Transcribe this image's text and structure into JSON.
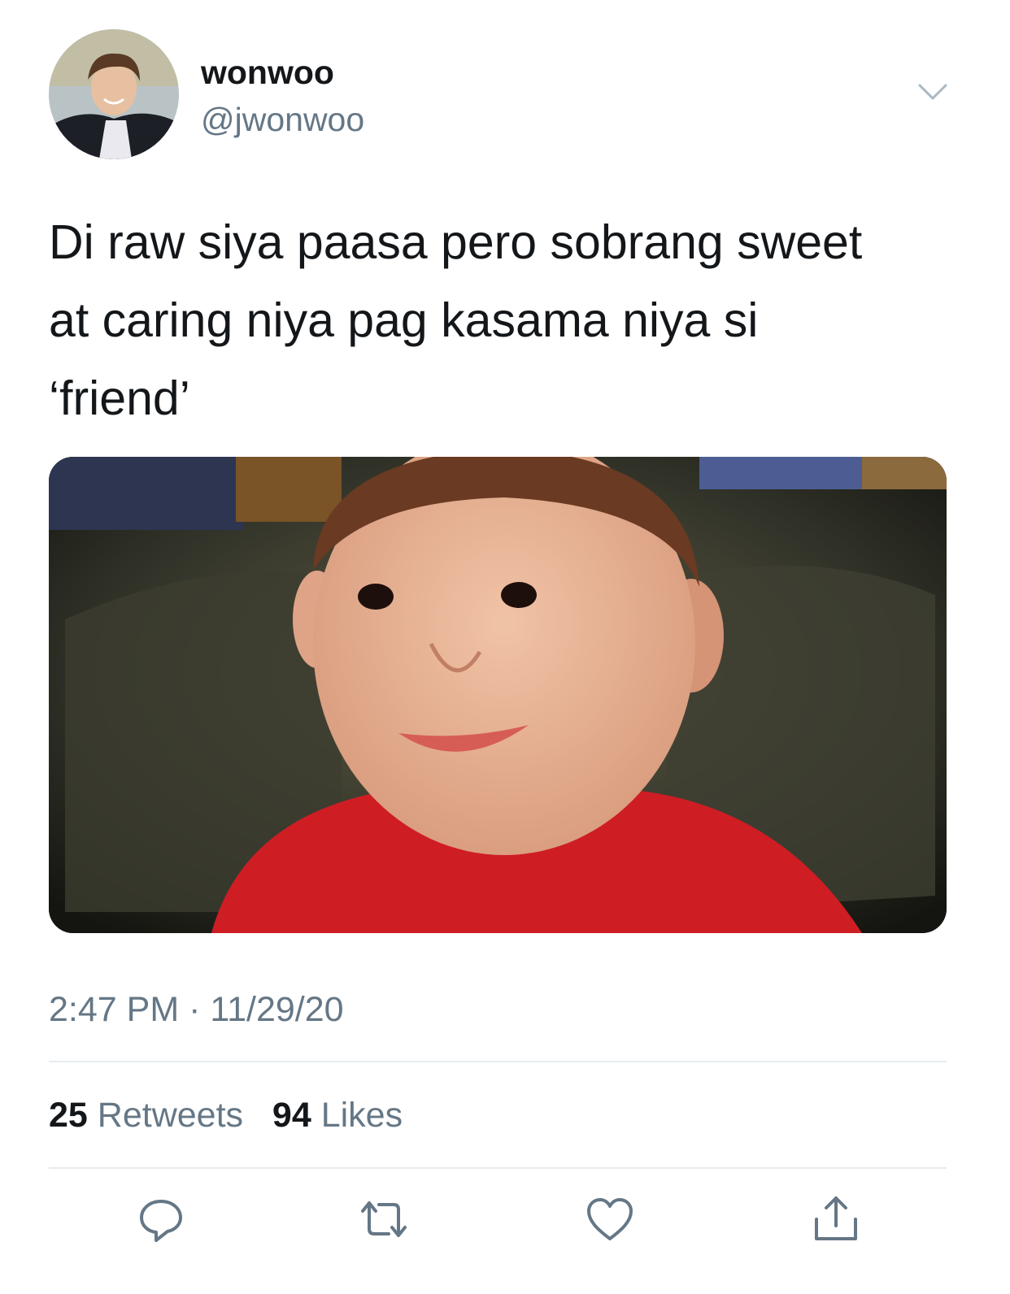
{
  "author": {
    "name": "wonwoo",
    "handle": "@jwonwoo"
  },
  "tweet": {
    "lines": [
      "Di raw siya paasa pero sobrang sweet",
      "at caring niya pag kasama niya si",
      "‘friend’"
    ],
    "time": "2:47 PM",
    "separator": "·",
    "date": "11/29/20"
  },
  "stats": {
    "retweets_count": "25",
    "retweets_label": "Retweets",
    "likes_count": "94",
    "likes_label": "Likes"
  },
  "icons": {
    "more": "chevron-down-icon",
    "reply": "reply-icon",
    "retweet": "retweet-icon",
    "like": "heart-icon",
    "share": "share-icon"
  },
  "colors": {
    "text_primary": "#14171a",
    "text_secondary": "#657786",
    "divider": "#e6ecf0"
  }
}
